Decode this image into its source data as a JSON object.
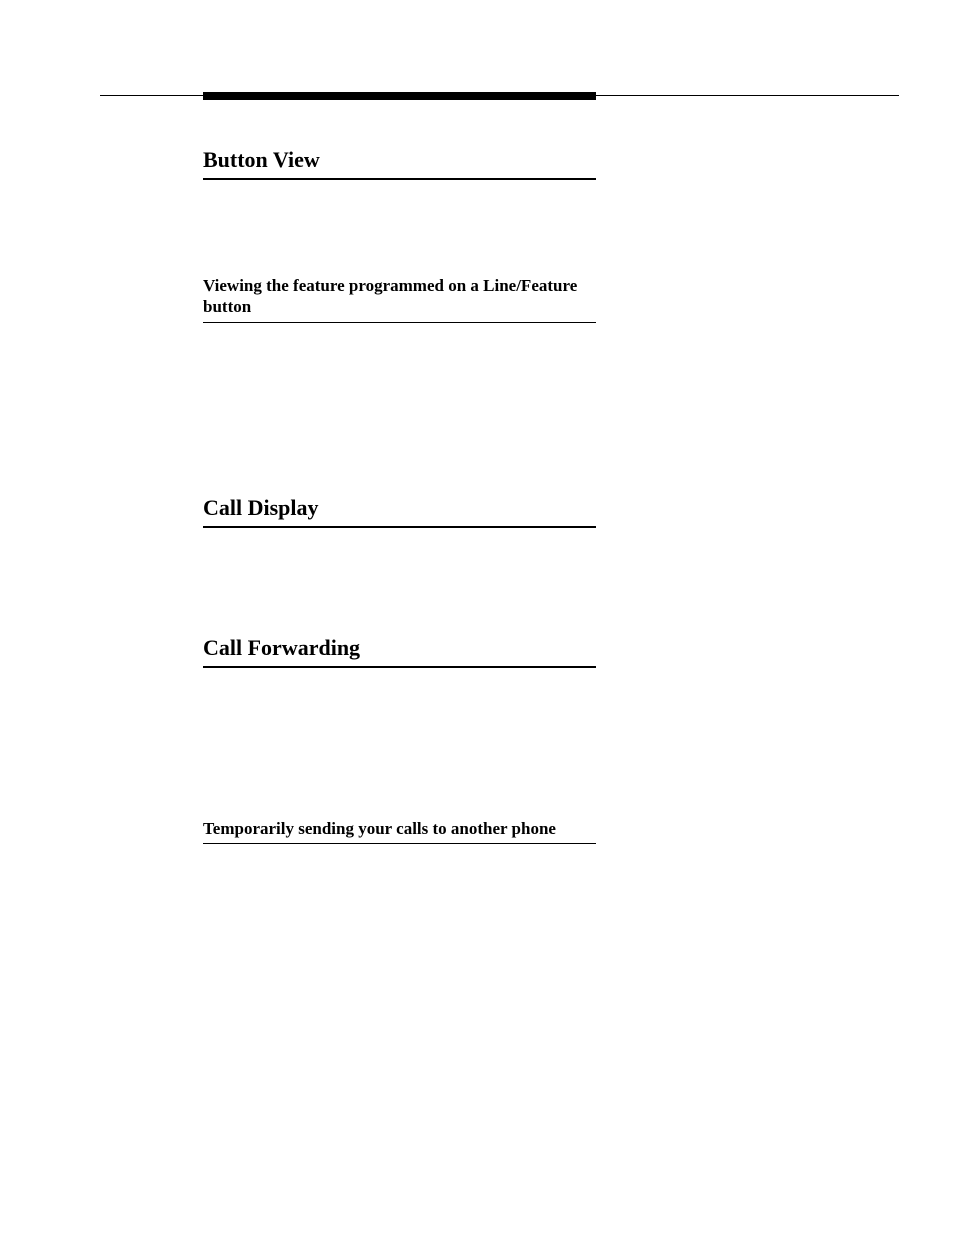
{
  "sections": {
    "button_view": {
      "heading": "Button View",
      "subheading": "Viewing the feature programmed on a Line/Feature button"
    },
    "call_display": {
      "heading": "Call Display"
    },
    "call_forwarding": {
      "heading": "Call Forwarding",
      "subheading": "Temporarily sending your calls to another phone"
    }
  }
}
